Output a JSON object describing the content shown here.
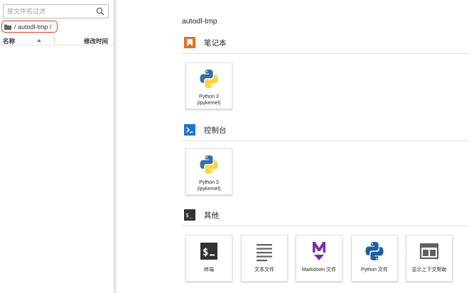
{
  "file_browser": {
    "search_placeholder": "按文件名过滤",
    "breadcrumb": "/ autodl-tmp /",
    "columns": {
      "name": "名称",
      "modified": "修改时间"
    },
    "highlight_color": "#e03b24"
  },
  "launcher": {
    "cwd": "autodl-tmp",
    "sections": {
      "notebook": {
        "title": "笔记本",
        "icon": "notebook-icon",
        "cards": [
          {
            "line1": "Python 3",
            "line2": "(ipykernel)",
            "icon": "python-logo-icon"
          }
        ]
      },
      "console": {
        "title": "控制台",
        "icon": "console-icon",
        "cards": [
          {
            "line1": "Python 3",
            "line2": "(ipykernel)",
            "icon": "python-logo-icon"
          }
        ]
      },
      "other": {
        "title": "其他",
        "icon": "other-icon",
        "cards": [
          {
            "label": "终端",
            "icon": "terminal-icon"
          },
          {
            "label": "文本文件",
            "icon": "text-file-icon"
          },
          {
            "label": "Markdown 文件",
            "icon": "markdown-icon"
          },
          {
            "label": "Python 文件",
            "icon": "python-file-icon"
          },
          {
            "label": "显示上下文帮助",
            "icon": "context-help-icon"
          }
        ]
      }
    }
  },
  "colors": {
    "notebook_orange": "#e46f23",
    "console_blue": "#1976d2",
    "terminal_dark": "#333333",
    "markdown_purple": "#7b2ba6",
    "python_blue": "#3770a1",
    "python_yellow": "#fed442"
  }
}
